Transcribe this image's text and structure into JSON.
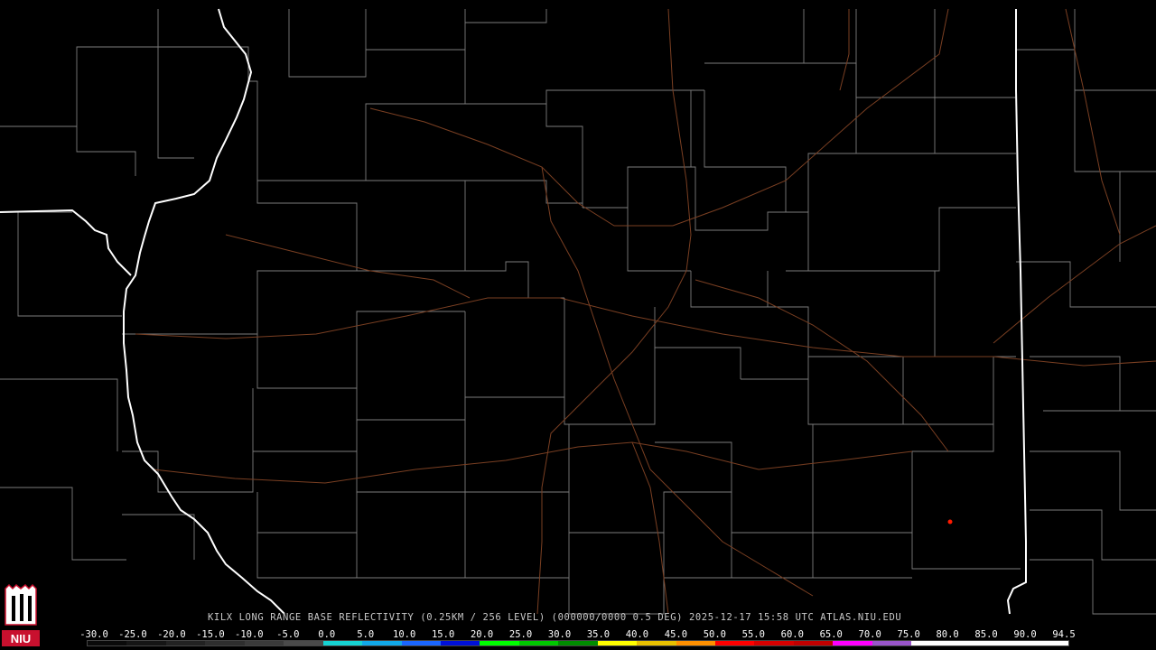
{
  "product": {
    "caption": "KILX LONG RANGE BASE REFLECTIVITY (0.25KM / 256 LEVEL) (000000/0000 0.5 DEG) 2025-12-17 15:58 UTC  ATLAS.NIU.EDU"
  },
  "logo": {
    "text": "NIU",
    "colors": {
      "red": "#c8102e",
      "white": "#ffffff",
      "black": "#000000"
    }
  },
  "color_scale": {
    "unit_values": [
      "-30.0",
      "-25.0",
      "-20.0",
      "-15.0",
      "-10.0",
      "-5.0",
      "0.0",
      "5.0",
      "10.0",
      "15.0",
      "20.0",
      "25.0",
      "30.0",
      "35.0",
      "40.0",
      "45.0",
      "50.0",
      "55.0",
      "60.0",
      "65.0",
      "70.0",
      "75.0",
      "80.0",
      "85.0",
      "90.0",
      "94.5"
    ],
    "colors": [
      "#0a0a0a",
      "#151515",
      "#222222",
      "#2e2e2e",
      "#3a3a3a",
      "#4a4a4a",
      "#16d2d2",
      "#11a8e8",
      "#1a66ff",
      "#0010d8",
      "#00ff00",
      "#00c800",
      "#008c00",
      "#ffff00",
      "#e7c000",
      "#ff9000",
      "#ff0000",
      "#d60000",
      "#c00000",
      "#ff00ff",
      "#9955c9",
      "#ffffff",
      "#ffffff",
      "#ffffff",
      "#ffffff"
    ]
  },
  "map_colors": {
    "background": "#000000",
    "county_lines": "#8a8a8a",
    "state_lines": "#ffffff",
    "roads": "#8b4a2b"
  },
  "radar_site": {
    "name": "KILX"
  }
}
